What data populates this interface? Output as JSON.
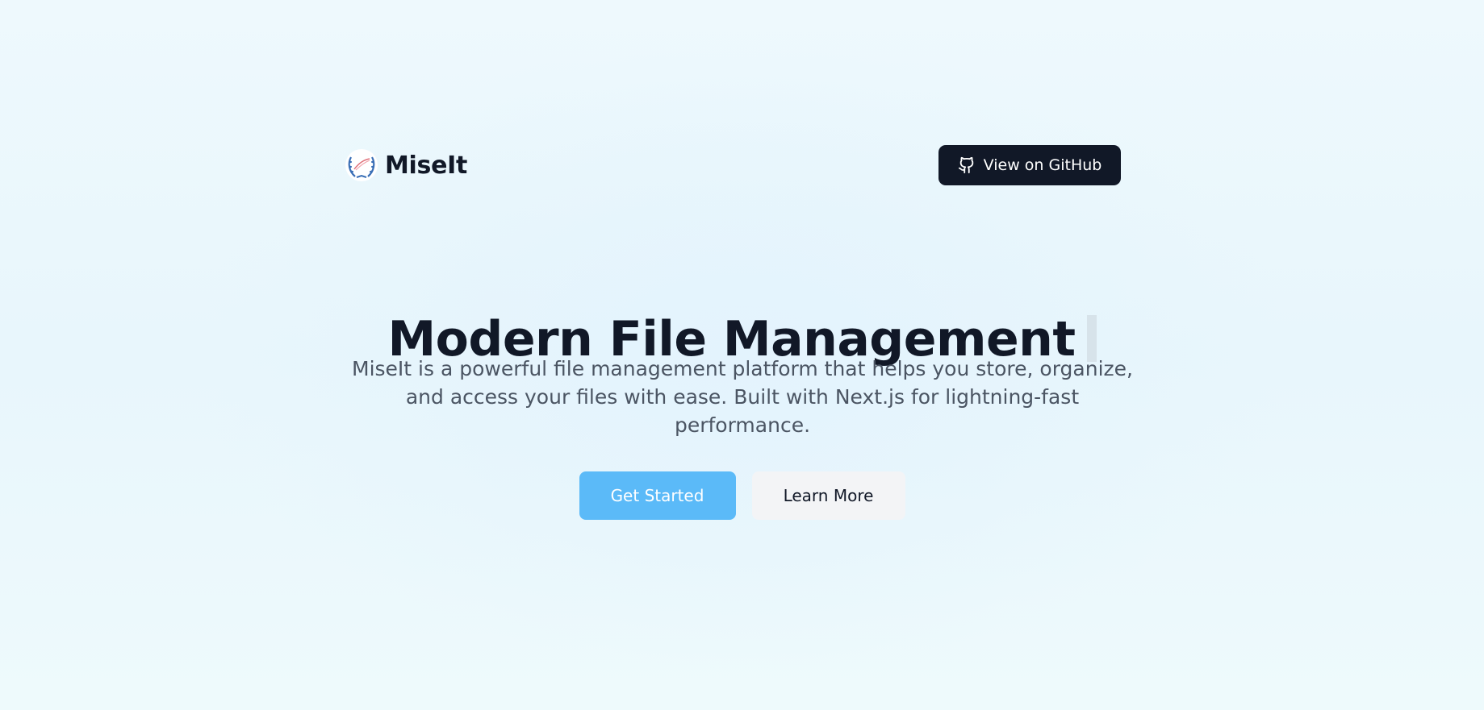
{
  "header": {
    "brand_name": "MiseIt",
    "logo_icon": "laurel-wreath-logo",
    "github_label": "View on GitHub",
    "github_icon": "github-icon"
  },
  "hero": {
    "title": "Modern File Management",
    "subtitle_line1": "MiseIt is a powerful file management platform that helps you store, organize,",
    "subtitle_line2": "and access your files with ease. Built with Next.js for lightning-fast",
    "subtitle_line3": "performance."
  },
  "cta": {
    "primary_label": "Get Started",
    "secondary_label": "Learn More"
  },
  "colors": {
    "primary": "#5bbaf8",
    "dark": "#111827",
    "text_muted": "#4b5563",
    "secondary_bg": "#f3f4f6"
  }
}
